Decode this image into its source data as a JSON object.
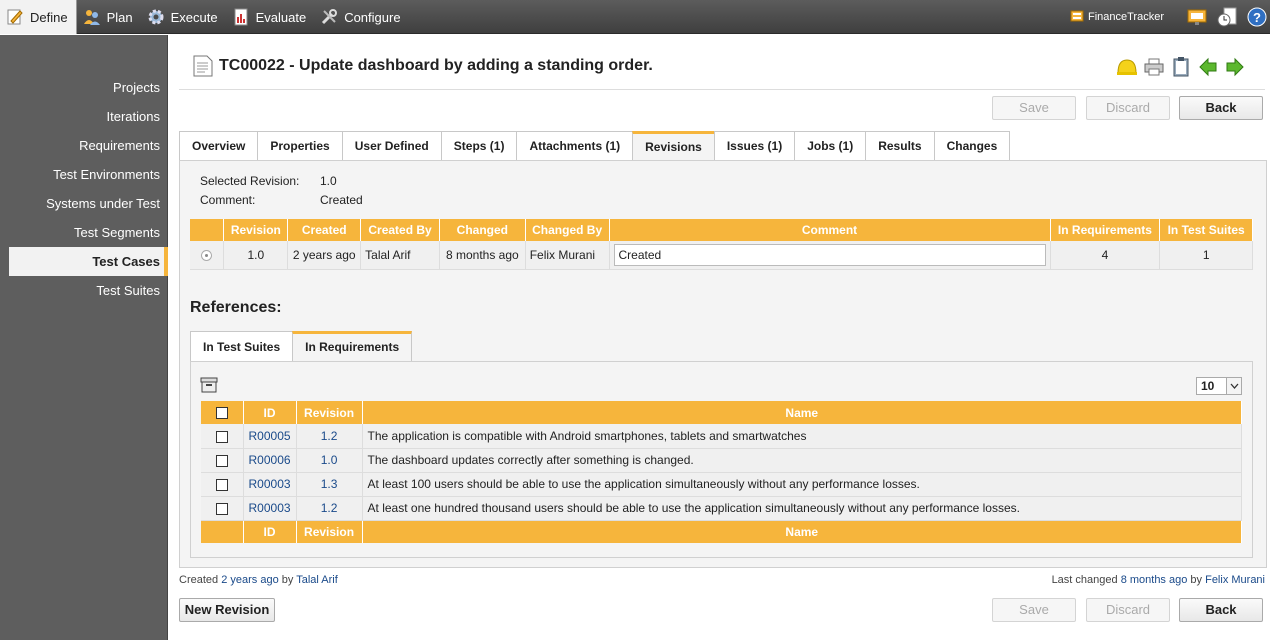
{
  "topnav": {
    "items": [
      {
        "label": "Define",
        "icon": "pencil-paper-icon"
      },
      {
        "label": "Plan",
        "icon": "people-icon"
      },
      {
        "label": "Execute",
        "icon": "gear-icon"
      },
      {
        "label": "Evaluate",
        "icon": "report-icon"
      },
      {
        "label": "Configure",
        "icon": "tools-icon"
      }
    ],
    "project": "FinanceTracker"
  },
  "sidebar": {
    "items": [
      {
        "label": "Projects"
      },
      {
        "label": "Iterations"
      },
      {
        "label": "Requirements"
      },
      {
        "label": "Test Environments"
      },
      {
        "label": "Systems under Test"
      },
      {
        "label": "Test Segments"
      },
      {
        "label": "Test Cases"
      },
      {
        "label": "Test Suites"
      }
    ],
    "active": "Test Cases"
  },
  "page": {
    "title": "TC00022 - Update dashboard by adding a standing order.",
    "save": "Save",
    "discard": "Discard",
    "back": "Back",
    "new_revision": "New Revision"
  },
  "tabs": [
    {
      "label": "Overview"
    },
    {
      "label": "Properties"
    },
    {
      "label": "User Defined"
    },
    {
      "label": "Steps (1)"
    },
    {
      "label": "Attachments (1)"
    },
    {
      "label": "Revisions"
    },
    {
      "label": "Issues (1)"
    },
    {
      "label": "Jobs (1)"
    },
    {
      "label": "Results"
    },
    {
      "label": "Changes"
    }
  ],
  "active_tab": "Revisions",
  "revision_info": {
    "selected_label": "Selected Revision:",
    "selected_value": "1.0",
    "comment_label": "Comment:",
    "comment_value": "Created"
  },
  "revisions_table": {
    "headers": [
      "Revision",
      "Created",
      "Created By",
      "Changed",
      "Changed By",
      "Comment",
      "In Requirements",
      "In Test Suites"
    ],
    "rows": [
      {
        "revision": "1.0",
        "created": "2 years ago",
        "created_by": "Talal Arif",
        "changed": "8 months ago",
        "changed_by": "Felix Murani",
        "comment": "Created",
        "in_requirements": "4",
        "in_test_suites": "1"
      }
    ]
  },
  "references": {
    "title": "References:",
    "tabs": [
      {
        "label": "In Test Suites"
      },
      {
        "label": "In Requirements"
      }
    ],
    "active_tab": "In Requirements",
    "page_size": "10",
    "headers": [
      "ID",
      "Revision",
      "Name"
    ],
    "rows": [
      {
        "id": "R00005",
        "revision": "1.2",
        "name": "The application is compatible with Android smartphones, tablets and smartwatches"
      },
      {
        "id": "R00006",
        "revision": "1.0",
        "name": "The dashboard updates correctly after something is changed."
      },
      {
        "id": "R00003",
        "revision": "1.3",
        "name": "At least 100 users should be able to use the application simultaneously without any performance losses."
      },
      {
        "id": "R00003",
        "revision": "1.2",
        "name": "At least one hundred thousand users should be able to use the application simultaneously without any performance losses."
      }
    ]
  },
  "footer": {
    "created_prefix": "Created",
    "created_when": "2 years ago",
    "by": "by",
    "created_by": "Talal Arif",
    "changed_prefix": "Last changed",
    "changed_when": "8 months ago",
    "changed_by": "Felix Murani"
  },
  "colors": {
    "accent": "#f6b53c",
    "link": "#1a4a8a",
    "topbar": "#4a4a4a",
    "sidebar": "#5e5e5e"
  }
}
